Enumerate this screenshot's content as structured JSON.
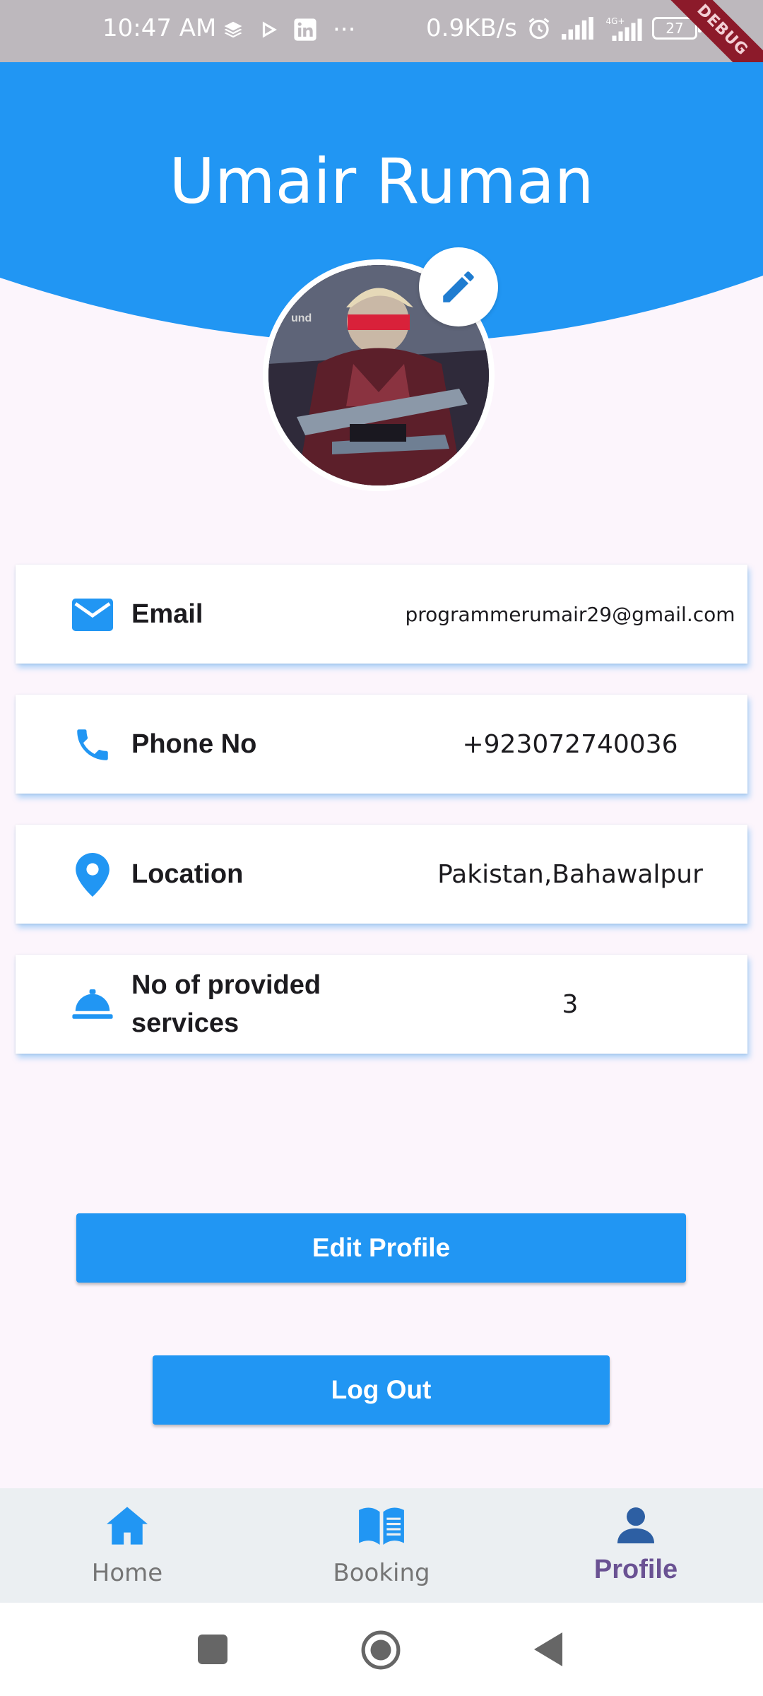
{
  "status_bar": {
    "time": "10:47 AM",
    "speed": "0.9KB/s",
    "battery": "27",
    "debug_banner": "DEBUG"
  },
  "profile": {
    "name": "Umair Ruman"
  },
  "info": [
    {
      "label": "Email",
      "value": "programmerumair29@gmail.com",
      "icon": "email-icon"
    },
    {
      "label": "Phone No",
      "value": "+923072740036",
      "icon": "phone-icon"
    },
    {
      "label": "Location",
      "value": "Pakistan,Bahawalpur",
      "icon": "location-pin-icon"
    },
    {
      "label": "No of provided services",
      "value": "3",
      "icon": "service-bell-icon"
    }
  ],
  "actions": {
    "edit_profile": "Edit Profile",
    "log_out": "Log Out"
  },
  "bottom_nav": [
    {
      "label": "Home",
      "icon": "home-icon",
      "active": false
    },
    {
      "label": "Booking",
      "icon": "book-icon",
      "active": false
    },
    {
      "label": "Profile",
      "icon": "person-icon",
      "active": true
    }
  ],
  "colors": {
    "primary": "#2196f3",
    "active_nav": "#6a5293",
    "background": "#fcf5fc"
  }
}
